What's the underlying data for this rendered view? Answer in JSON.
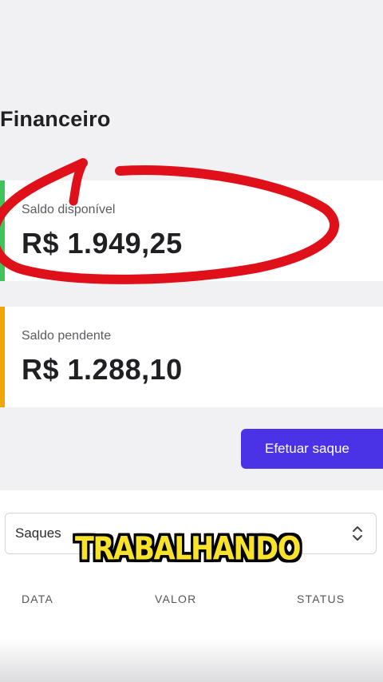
{
  "page": {
    "title": "Financeiro"
  },
  "balances": {
    "available": {
      "label": "Saldo disponível",
      "amount": "R$ 1.949,25",
      "accent_color": "#3fc45a"
    },
    "pending": {
      "label": "Saldo pendente",
      "amount": "R$ 1.288,10",
      "accent_color": "#f0a500"
    }
  },
  "actions": {
    "withdraw_label": "Efetuar saque",
    "withdraw_color": "#4a33e6"
  },
  "filter": {
    "selected": "Saques"
  },
  "table": {
    "columns": [
      "DATA",
      "VALOR",
      "STATUS"
    ]
  },
  "overlay": {
    "caption": "TRABALHANDO",
    "annotation_color": "#e0101a"
  },
  "icons": {
    "select_chevron": "chevron-up-down-icon"
  }
}
